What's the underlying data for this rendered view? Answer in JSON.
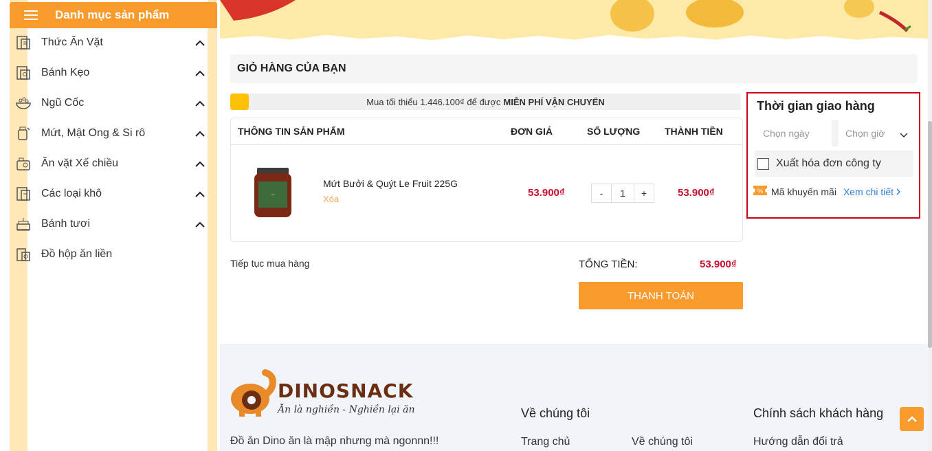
{
  "sidebar": {
    "header_title": "Danh mục sản phẩm",
    "items": [
      {
        "label": "Thức Ăn Vặt",
        "icon": "snack-icon",
        "expandable": true
      },
      {
        "label": "Bánh Kẹo",
        "icon": "candy-icon",
        "expandable": true
      },
      {
        "label": "Ngũ Cốc",
        "icon": "cereal-bowl-icon",
        "expandable": true
      },
      {
        "label": "Mứt, Mật Ong & Si rô",
        "icon": "honey-jar-icon",
        "expandable": true
      },
      {
        "label": "Ăn vặt Xế chiều",
        "icon": "afternoon-snack-icon",
        "expandable": true
      },
      {
        "label": "Các loại khô",
        "icon": "dried-food-icon",
        "expandable": true
      },
      {
        "label": "Bánh tươi",
        "icon": "cake-icon",
        "expandable": true
      },
      {
        "label": "Đồ hộp ăn liền",
        "icon": "canned-food-icon",
        "expandable": false
      }
    ]
  },
  "cart": {
    "title": "GIỎ HÀNG CỦA BẠN",
    "promo_text": "Mua tối thiểu 1.446.100₫ để được",
    "promo_bold": "MIỄN PHÍ VẬN CHUYỂN",
    "columns": {
      "product": "THÔNG TIN SẢN PHẨM",
      "unit_price": "ĐƠN GIÁ",
      "quantity": "SỐ LƯỢNG",
      "subtotal": "THÀNH TIỀN"
    },
    "items": [
      {
        "name": "Mứt Bưởi & Quýt Le Fruit 225G",
        "remove_label": "Xóa",
        "unit_price": "53.900₫",
        "quantity": "1",
        "subtotal": "53.900₫"
      }
    ],
    "qty_minus": "-",
    "qty_plus": "+",
    "continue_label": "Tiếp tục mua hàng",
    "total_label": "TỔNG TIỀN:",
    "total_value": "53.900₫",
    "checkout_label": "THANH TOÁN"
  },
  "delivery": {
    "title": "Thời gian giao hàng",
    "date_placeholder": "Chọn ngày",
    "time_placeholder": "Chọn giờ",
    "invoice_label": "Xuất hóa đơn công ty",
    "invoice_checked": false,
    "coupon_label": "Mã khuyến mãi",
    "coupon_link": "Xem chi tiết"
  },
  "footer": {
    "brand": "DINOSNACK",
    "brand_tagline": "Ăn là nghiền - Nghiền lại ăn",
    "tagline": "Đồ ăn Dino ăn là mập nhưng mà ngonnn!!!",
    "col_about_title": "Về chúng tôi",
    "col_about_links": [
      "Trang chủ",
      "Về chúng tôi"
    ],
    "col_policy_title": "Chính sách khách hàng",
    "col_policy_links": [
      "Hướng dẫn đổi trả"
    ]
  },
  "colors": {
    "accent": "#f89a2c",
    "price": "#c8102e",
    "highlight_border": "#d0021b",
    "link": "#2f7bd6"
  }
}
